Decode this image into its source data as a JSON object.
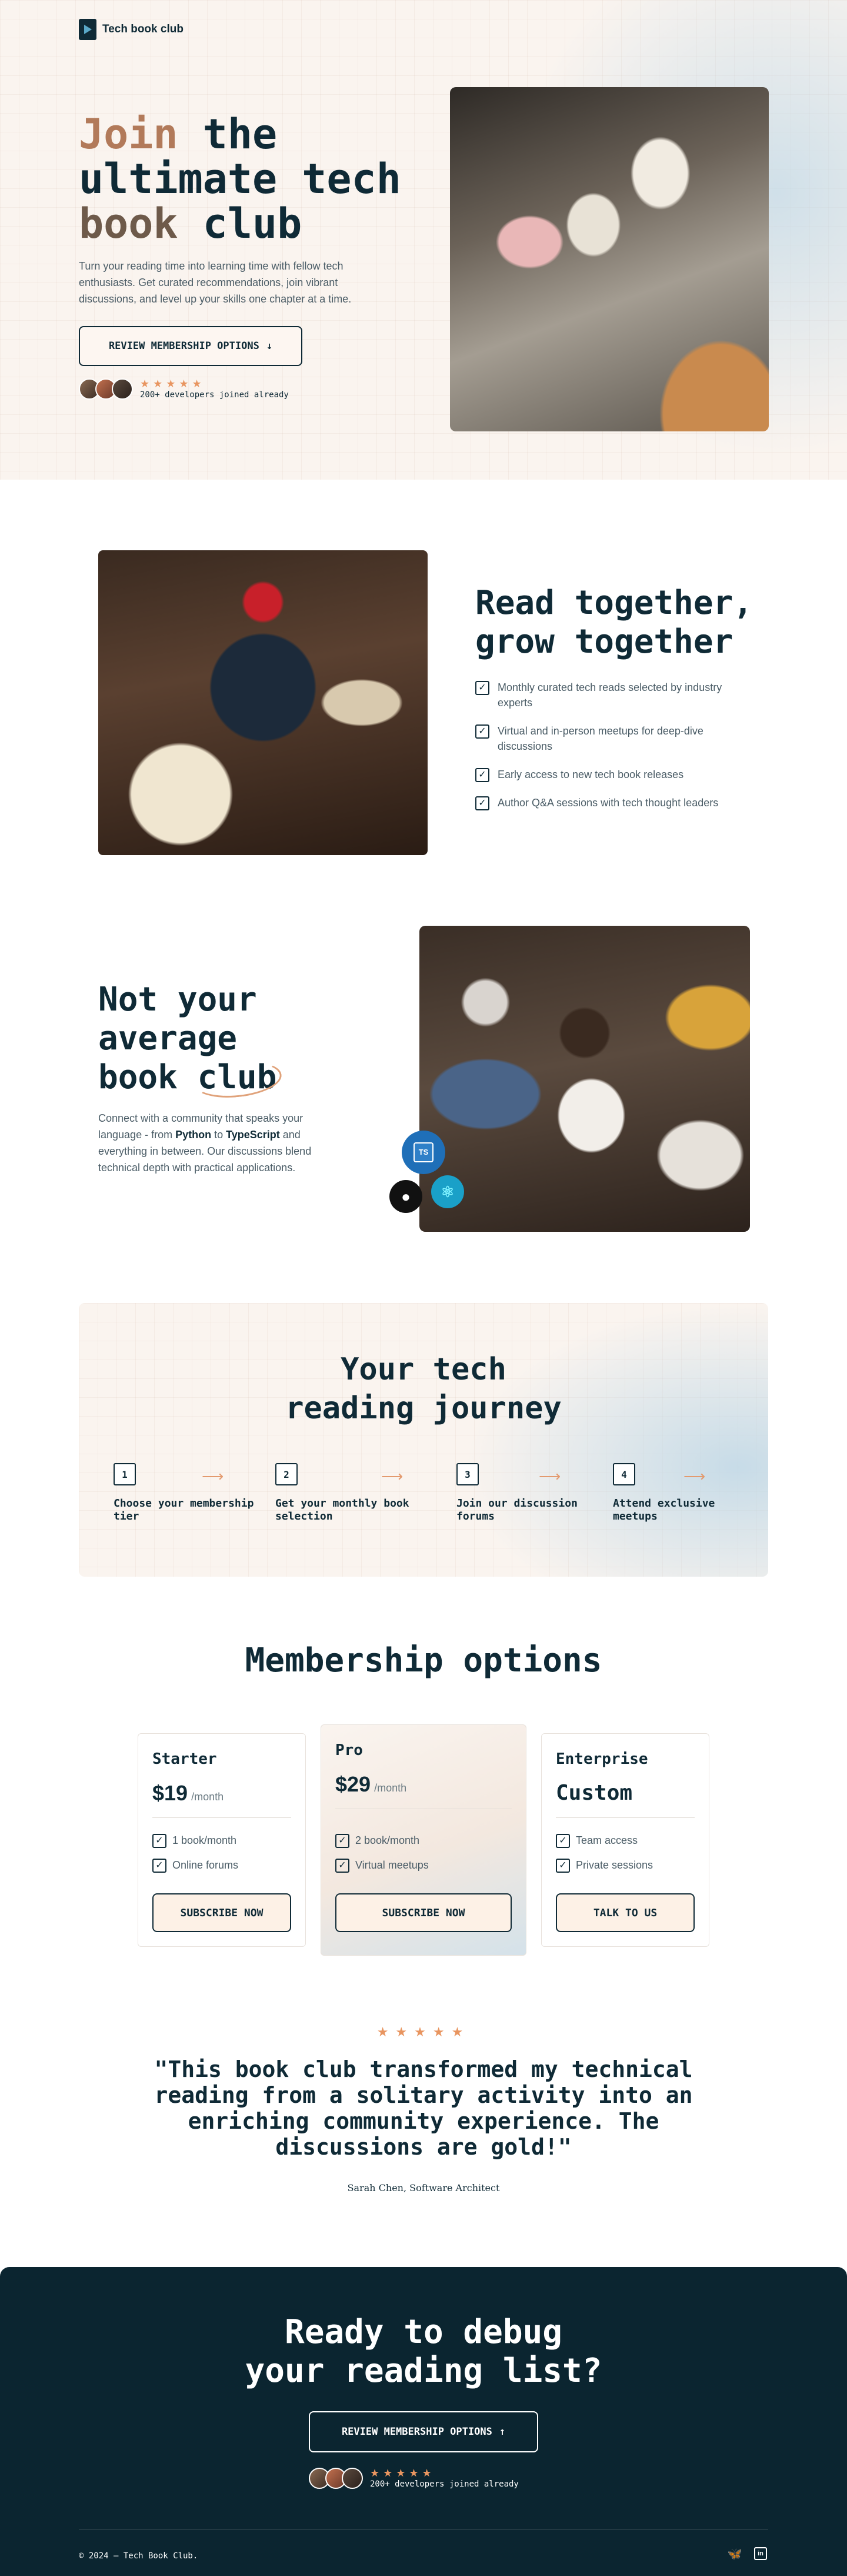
{
  "brand": {
    "name": "Tech book club"
  },
  "hero": {
    "title_join": "Join",
    "title_the": " the",
    "title_line2": "ultimate tech",
    "title_book": "book",
    "title_club": " club",
    "subtitle": "Turn your reading time into learning time with fellow tech enthusiasts. Get curated recommendations, join vibrant discussions, and level up your skills one chapter at a time.",
    "cta_label": "REVIEW MEMBERSHIP OPTIONS",
    "cta_icon": "arrow-down-icon",
    "stars": "★★★★★",
    "social_proof": "200+ developers joined already"
  },
  "features": {
    "title_line1": "Read together,",
    "title_line2": "grow together",
    "items": [
      {
        "label": "Monthly curated tech reads selected by industry experts"
      },
      {
        "label": "Virtual and in-person meetups for deep-dive discussions"
      },
      {
        "label": "Early access to new tech book releases"
      },
      {
        "label": "Author Q&A sessions with tech thought leaders"
      }
    ]
  },
  "community": {
    "title_line1": "Not your",
    "title_line2": "average",
    "title_line3a": "book ",
    "title_line3b": "club",
    "desc_1": "Connect with a community that speaks your language - from ",
    "desc_python": "Python",
    "desc_2": " to ",
    "desc_ts": "TypeScript",
    "desc_3": " and everything in between. Our discussions blend technical depth with practical applications.",
    "badge_ts": "TS"
  },
  "journey": {
    "title_line1": "Your tech",
    "title_line2": "reading journey",
    "steps": [
      {
        "num": "1",
        "label": "Choose your membership tier"
      },
      {
        "num": "2",
        "label": "Get your monthly book selection"
      },
      {
        "num": "3",
        "label": "Join our discussion forums"
      },
      {
        "num": "4",
        "label": "Attend exclusive meetups"
      }
    ]
  },
  "pricing": {
    "title": "Membership options",
    "plans": [
      {
        "name": "Starter",
        "price": "$19",
        "period": "/month",
        "features": [
          "1 book/month",
          "Online forums"
        ],
        "button": "SUBSCRIBE NOW"
      },
      {
        "name": "Pro",
        "price": "$29",
        "period": "/month",
        "features": [
          "2 book/month",
          "Virtual meetups"
        ],
        "button": "SUBSCRIBE NOW"
      },
      {
        "name": "Enterprise",
        "price": "Custom",
        "period": "",
        "features": [
          "Team access",
          "Private sessions"
        ],
        "button": "TALK TO US"
      }
    ]
  },
  "testimonial": {
    "stars": "★★★★★",
    "quote": "\"This book club transformed my technical reading from a solitary activity into an enriching community experience. The discussions are gold!\"",
    "author": "Sarah Chen, Software Architect"
  },
  "cta": {
    "title_line1": "Ready to debug",
    "title_line2": "your reading list?",
    "button_label": "REVIEW MEMBERSHIP OPTIONS",
    "button_icon": "arrow-up-icon",
    "stars": "★★★★★",
    "social_proof": "200+ developers joined already"
  },
  "footer": {
    "copyright": "© 2024 — Tech Book Club.",
    "icons": [
      "bluesky-icon",
      "linkedin-icon"
    ]
  },
  "colors": {
    "accent": "#e89560",
    "dark": "#0b2530",
    "text": "#0f2a36",
    "ts_blue": "#1f6fb8",
    "react_cyan": "#1aa0c8"
  }
}
